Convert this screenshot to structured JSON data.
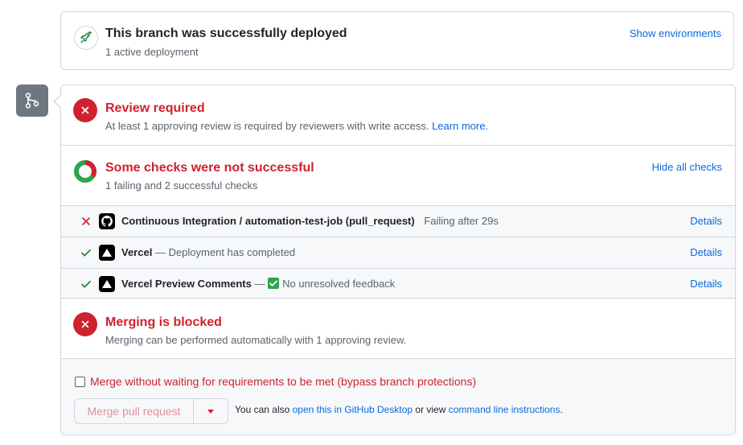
{
  "deployment": {
    "title": "This branch was successfully deployed",
    "subtitle": "1 active deployment",
    "show_environments": "Show environments",
    "icon": "rocket-icon"
  },
  "merge_panel": {
    "badge_icon": "git-branch-icon",
    "review": {
      "title": "Review required",
      "description": "At least 1 approving review is required by reviewers with write access.",
      "learn_more": "Learn more."
    },
    "checks": {
      "title": "Some checks were not successful",
      "summary": "1 failing and 2 successful checks",
      "hide_all": "Hide all checks",
      "failing_count": 1,
      "successful_count": 2,
      "items": [
        {
          "status": "failure",
          "icon": "github-icon",
          "name": "Continuous Integration / automation-test-job (pull_request)",
          "description": "Failing after 29s",
          "details": "Details"
        },
        {
          "status": "success",
          "icon": "vercel-icon",
          "name": "Vercel",
          "description": "— Deployment has completed",
          "details": "Details"
        },
        {
          "status": "success",
          "icon": "vercel-icon",
          "name": "Vercel Preview Comments",
          "description_prefix": "—",
          "description": "No unresolved feedback",
          "details": "Details"
        }
      ]
    },
    "blocked": {
      "title": "Merging is blocked",
      "description": "Merging can be performed automatically with 1 approving review."
    },
    "footer": {
      "bypass_label": "Merge without waiting for requirements to be met (bypass branch protections)",
      "merge_button": "Merge pull request",
      "alt_prefix": "You can also",
      "desktop_link": "open this in GitHub Desktop",
      "alt_middle": "or view",
      "cli_link": "command line instructions",
      "alt_suffix": "."
    }
  },
  "colors": {
    "danger": "#cf222e",
    "success": "#1a7f37",
    "link": "#0969da",
    "border": "#d0d7de"
  }
}
